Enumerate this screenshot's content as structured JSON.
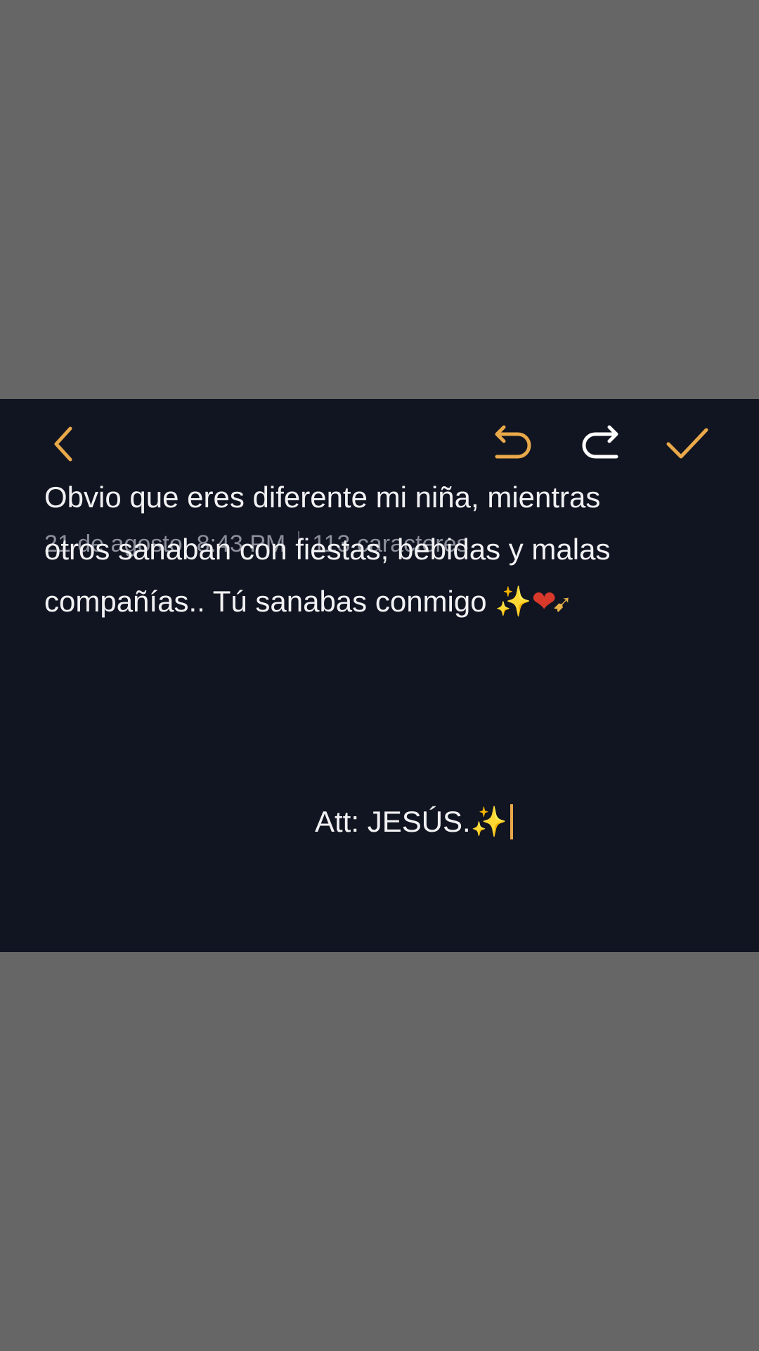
{
  "note": {
    "date": "21 de agosto",
    "time": "8:43 PM",
    "char_count": "113 caracteres",
    "lines": [
      "Obvio que eres diferente mi niña, mientras",
      "otros sanaban con fiestas, bebidas y malas",
      "compañías.. Tú sanabas conmigo"
    ],
    "line3_emoji_sparkles": "✨",
    "line3_emoji_heart": "❤",
    "line3_emoji_arrow": "➹",
    "signature": "Att: JESÚS.",
    "signature_emoji": "✨"
  },
  "toolbar": {
    "back_icon": "chevron-left-icon",
    "undo_icon": "undo-icon",
    "redo_icon": "redo-icon",
    "done_icon": "checkmark-icon"
  },
  "colors": {
    "panel_background": "#111421",
    "accent": "#e9a94a",
    "outer_background": "#666666",
    "meta_text": "#8c8f99",
    "body_text": "#f1f1f3"
  }
}
